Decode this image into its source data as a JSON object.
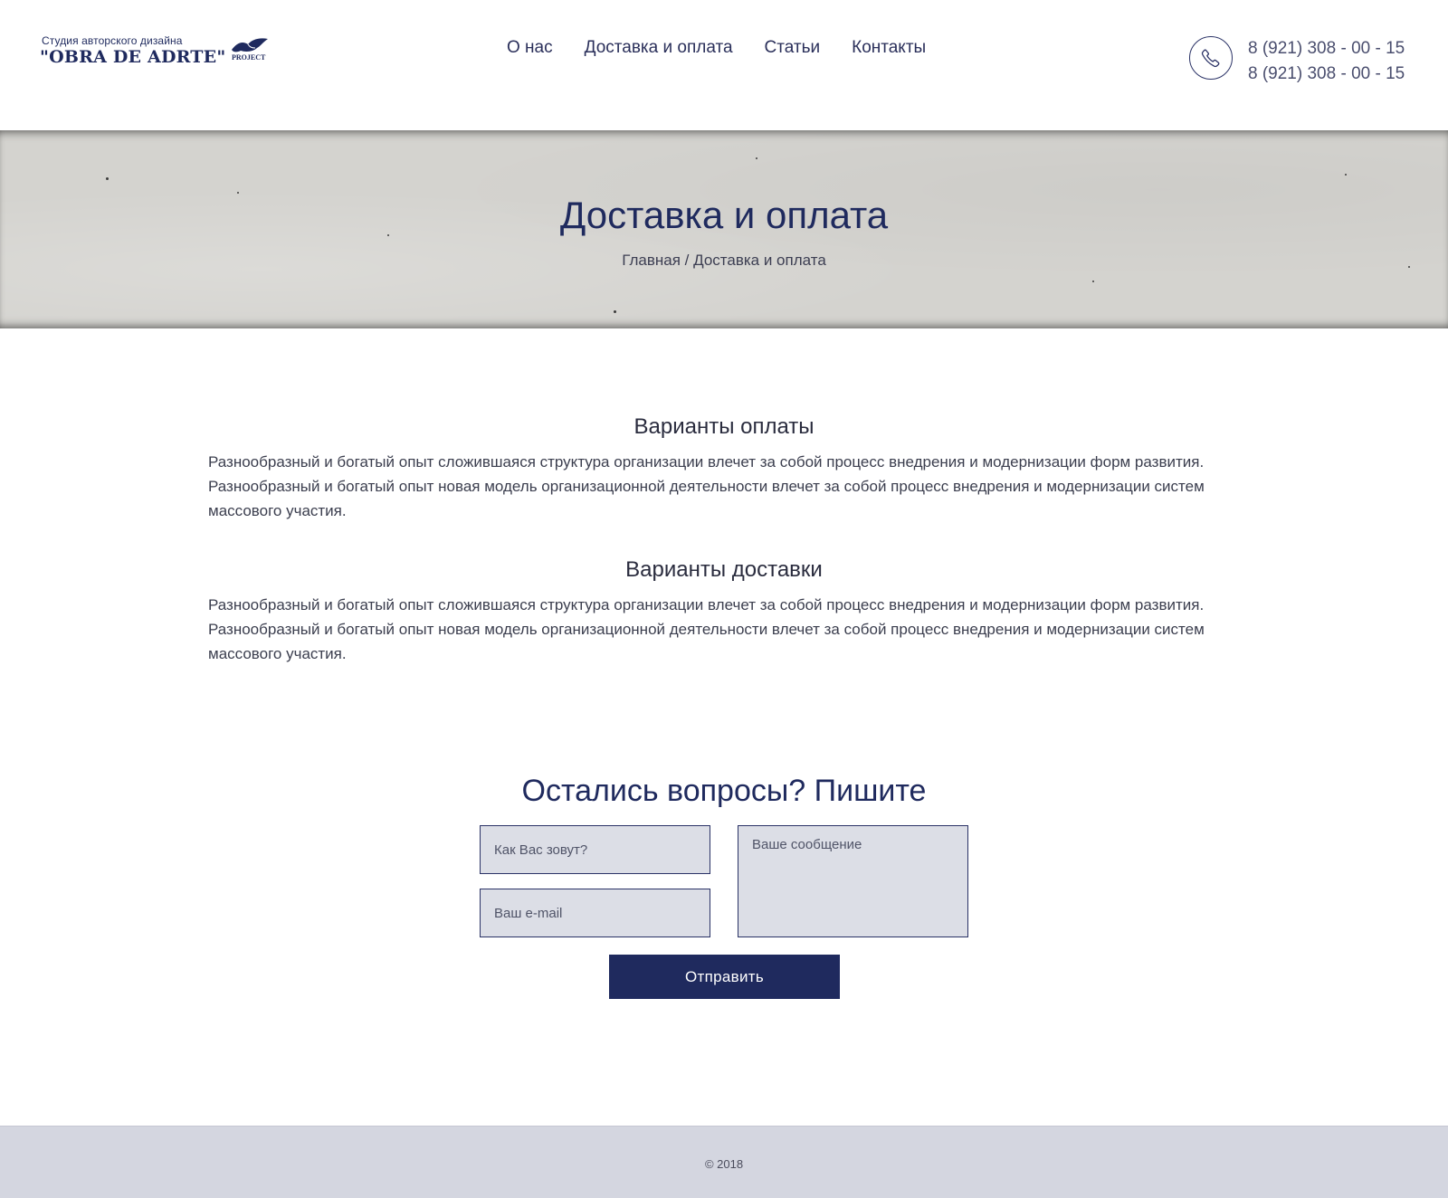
{
  "brand": {
    "tagline": "Студия авторского дизайна",
    "name": "\"OBRA DE ADRTE\"",
    "suffix": "PROJECT"
  },
  "nav": {
    "items": [
      {
        "label": "О нас"
      },
      {
        "label": "Доставка и оплата"
      },
      {
        "label": "Статьи"
      },
      {
        "label": "Контакты"
      }
    ]
  },
  "contacts": {
    "phone1": "8 (921) 308 - 00 - 15",
    "phone2": "8 (921) 308 - 00 - 15",
    "icon": "phone-icon"
  },
  "hero": {
    "title": "Доставка и оплата",
    "breadcrumb_home": "Главная",
    "breadcrumb_separator": " / ",
    "breadcrumb_current": "Доставка и оплата"
  },
  "content": {
    "sections": [
      {
        "heading": "Варианты оплаты",
        "text": "Разнообразный и богатый опыт сложившаяся структура организации влечет за собой процесс внедрения и модернизации форм развития. Разнообразный и богатый опыт новая модель организационной деятельности влечет за собой процесс внедрения и модернизации систем массового участия."
      },
      {
        "heading": "Варианты доставки",
        "text": "Разнообразный и богатый опыт сложившаяся структура организации влечет за собой процесс внедрения и модернизации форм развития. Разнообразный и богатый опыт новая модель организационной деятельности влечет за собой процесс внедрения и модернизации систем массового участия."
      }
    ]
  },
  "form": {
    "title": "Остались вопросы? Пишите",
    "name_placeholder": "Как Вас зовут?",
    "email_placeholder": "Ваш e-mail",
    "message_placeholder": "Ваше сообщение",
    "submit_label": "Отправить"
  },
  "footer": {
    "copyright": "© 2018"
  },
  "colors": {
    "accent": "#1f2a5e",
    "hero_bg": "#d4d3cf",
    "field_bg": "#dcdee6",
    "footer_bg": "#d4d6e0"
  }
}
